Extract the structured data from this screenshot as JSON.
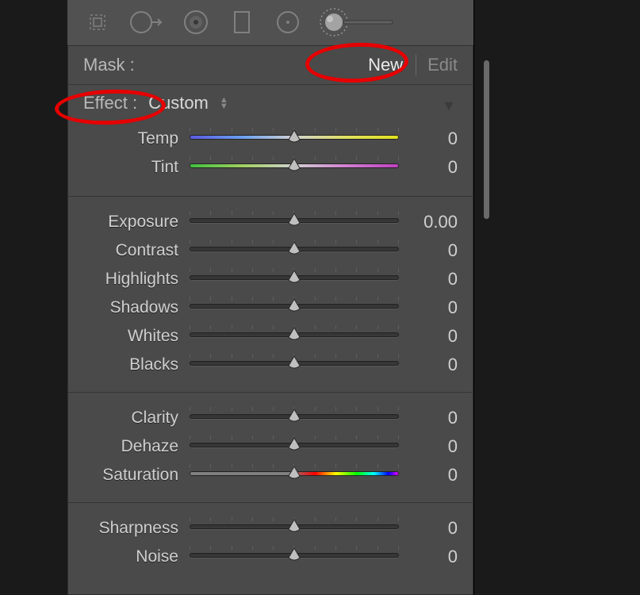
{
  "toolbar": {
    "tools": [
      "crop",
      "spot-removal",
      "redeye",
      "graduated-filter",
      "radial-filter",
      "adjustment-brush"
    ]
  },
  "mask": {
    "label": "Mask :",
    "new": "New",
    "edit": "Edit"
  },
  "effect": {
    "label": "Effect :",
    "value": "Custom"
  },
  "sliders": {
    "temp": {
      "label": "Temp",
      "value": "0"
    },
    "tint": {
      "label": "Tint",
      "value": "0"
    },
    "exposure": {
      "label": "Exposure",
      "value": "0.00"
    },
    "contrast": {
      "label": "Contrast",
      "value": "0"
    },
    "highlights": {
      "label": "Highlights",
      "value": "0"
    },
    "shadows": {
      "label": "Shadows",
      "value": "0"
    },
    "whites": {
      "label": "Whites",
      "value": "0"
    },
    "blacks": {
      "label": "Blacks",
      "value": "0"
    },
    "clarity": {
      "label": "Clarity",
      "value": "0"
    },
    "dehaze": {
      "label": "Dehaze",
      "value": "0"
    },
    "saturation": {
      "label": "Saturation",
      "value": "0"
    },
    "sharpness": {
      "label": "Sharpness",
      "value": "0"
    },
    "noise": {
      "label": "Noise",
      "value": "0"
    }
  }
}
